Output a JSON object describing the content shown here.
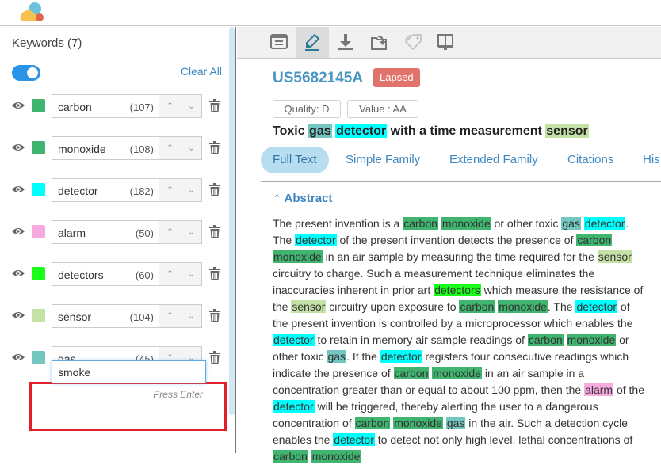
{
  "keywords_panel": {
    "title": "Keywords (7)",
    "highlight_toggle": true,
    "clear_all_label": "Clear All",
    "items": [
      {
        "name": "carbon",
        "count": "(107)",
        "color": "#3fb56f"
      },
      {
        "name": "monoxide",
        "count": "(108)",
        "color": "#3fb56f"
      },
      {
        "name": "detector",
        "count": "(182)",
        "color": "#00ffff"
      },
      {
        "name": "alarm",
        "count": "(50)",
        "color": "#f7aadf"
      },
      {
        "name": "detectors",
        "count": "(60)",
        "color": "#1aff1a"
      },
      {
        "name": "sensor",
        "count": "(104)",
        "color": "#c4e2a5"
      },
      {
        "name": "gas",
        "count": "(45)",
        "color": "#74c7c1"
      }
    ],
    "new_keyword": {
      "value": "smoke",
      "hint": "Press Enter"
    }
  },
  "toolbar": {
    "buttons": [
      {
        "name": "document-view",
        "icon": "document-icon"
      },
      {
        "name": "highlight",
        "icon": "highlighter-icon",
        "active": true
      },
      {
        "name": "download",
        "icon": "download-icon"
      },
      {
        "name": "export",
        "icon": "export-icon"
      },
      {
        "name": "tag",
        "icon": "tag-icon"
      },
      {
        "name": "compare",
        "icon": "split-view-icon"
      }
    ]
  },
  "patent": {
    "id": "US5682145A",
    "status": "Lapsed",
    "quality": "Quality: D",
    "value": "Value : AA",
    "title_segments": [
      {
        "text": "Toxic "
      },
      {
        "text": "gas",
        "kw": "gas"
      },
      {
        "text": " "
      },
      {
        "text": "detector",
        "kw": "detector"
      },
      {
        "text": " with a time measurement "
      },
      {
        "text": "sensor",
        "kw": "sensor"
      }
    ]
  },
  "tabs": [
    {
      "label": "Full Text",
      "active": true
    },
    {
      "label": "Simple Family"
    },
    {
      "label": "Extended Family"
    },
    {
      "label": "Citations"
    },
    {
      "label": "His"
    }
  ],
  "abstract": {
    "header": "Abstract",
    "segments": [
      {
        "text": "The present invention is a "
      },
      {
        "text": "carbon",
        "kw": "carbon"
      },
      {
        "text": " "
      },
      {
        "text": "monoxide",
        "kw": "monoxide"
      },
      {
        "text": " or other toxic "
      },
      {
        "text": "gas",
        "kw": "gas"
      },
      {
        "text": " "
      },
      {
        "text": "detector",
        "kw": "detector"
      },
      {
        "text": ". The "
      },
      {
        "text": "detector",
        "kw": "detector"
      },
      {
        "text": " of the present invention detects the presence of "
      },
      {
        "text": "carbon",
        "kw": "carbon"
      },
      {
        "text": " "
      },
      {
        "text": "monoxide",
        "kw": "monoxide"
      },
      {
        "text": " in an air sample by measuring the time required for the "
      },
      {
        "text": "sensor",
        "kw": "sensor"
      },
      {
        "text": " circuitry to charge. Such a measurement technique eliminates the inaccuracies inherent in prior art "
      },
      {
        "text": "detectors",
        "kw": "detectors"
      },
      {
        "text": " which measure the resistance of the "
      },
      {
        "text": "sensor",
        "kw": "sensor"
      },
      {
        "text": " circuitry upon exposure to "
      },
      {
        "text": "carbon",
        "kw": "carbon"
      },
      {
        "text": " "
      },
      {
        "text": "monoxide",
        "kw": "monoxide"
      },
      {
        "text": ". The "
      },
      {
        "text": "detector",
        "kw": "detector"
      },
      {
        "text": " of the present invention is controlled by a microprocessor which enables the "
      },
      {
        "text": "detector",
        "kw": "detector"
      },
      {
        "text": " to retain in memory air sample readings of "
      },
      {
        "text": "carbon",
        "kw": "carbon"
      },
      {
        "text": " "
      },
      {
        "text": "monoxide",
        "kw": "monoxide"
      },
      {
        "text": " or other toxic "
      },
      {
        "text": "gas",
        "kw": "gas"
      },
      {
        "text": ". If the "
      },
      {
        "text": "detector",
        "kw": "detector"
      },
      {
        "text": " registers four consecutive readings which indicate the presence of "
      },
      {
        "text": "carbon",
        "kw": "carbon"
      },
      {
        "text": " "
      },
      {
        "text": "monoxide",
        "kw": "monoxide"
      },
      {
        "text": " in an air sample in a concentration greater than or equal to about 100 ppm, then the "
      },
      {
        "text": "alarm",
        "kw": "alarm"
      },
      {
        "text": " of the "
      },
      {
        "text": "detector",
        "kw": "detector"
      },
      {
        "text": " will be triggered, thereby alerting the user to a dangerous concentration of "
      },
      {
        "text": "carbon",
        "kw": "carbon"
      },
      {
        "text": " "
      },
      {
        "text": "monoxide",
        "kw": "monoxide"
      },
      {
        "text": " "
      },
      {
        "text": "gas",
        "kw": "gas"
      },
      {
        "text": " in the air. Such a detection cycle enables the "
      },
      {
        "text": "detector",
        "kw": "detector"
      },
      {
        "text": " to detect not only high level, lethal concentrations of "
      },
      {
        "text": "carbon",
        "kw": "carbon"
      },
      {
        "text": " "
      },
      {
        "text": "monoxide",
        "kw": "monoxide"
      }
    ]
  }
}
